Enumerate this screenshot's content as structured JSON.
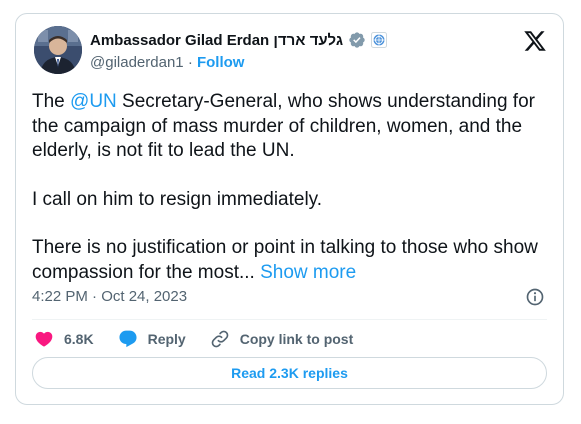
{
  "author": {
    "display_name": "Ambassador Gilad Erdan גלעד ארדן",
    "handle": "@giladerdan1",
    "separator": "·",
    "follow_label": "Follow",
    "avatar_icon": "profile-photo"
  },
  "tweet": {
    "mention": "@UN",
    "paragraph1_before": "The ",
    "paragraph1_after": " Secretary-General, who shows understanding for the campaign of mass murder of children, women, and the elderly, is not fit to lead the UN.",
    "paragraph2": "I call on him to resign immediately.",
    "paragraph3": "There is no justification or point in talking to those who show compassion for the most...",
    "show_more": "Show more",
    "timestamp": "4:22 PM · Oct 24, 2023"
  },
  "actions": {
    "likes_count": "6.8K",
    "reply_label": "Reply",
    "copy_link_label": "Copy link to post"
  },
  "replies_button": "Read 2.3K replies",
  "colors": {
    "accent": "#1d9bf0",
    "like": "#f91880",
    "verified_gray": "#829aab",
    "text": "#0f1419",
    "muted": "#536471"
  }
}
